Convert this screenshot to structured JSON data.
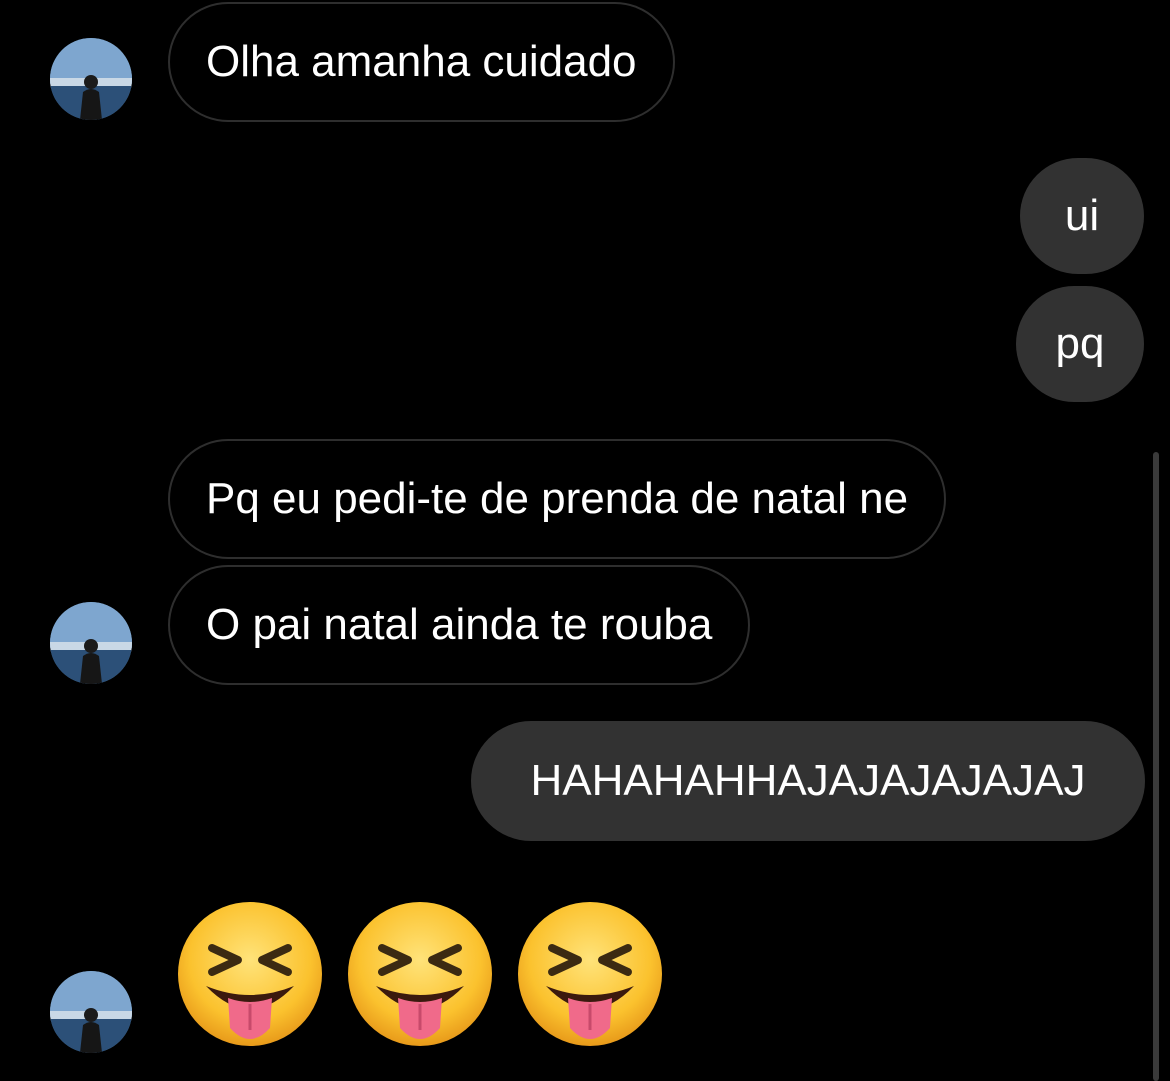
{
  "messages": [
    {
      "from": "them",
      "text": "Olha amanha cuidado"
    },
    {
      "from": "me",
      "text": "ui"
    },
    {
      "from": "me",
      "text": "pq"
    },
    {
      "from": "them",
      "text": "Pq eu pedi-te de prenda de natal ne"
    },
    {
      "from": "them",
      "text": "O pai natal ainda te rouba"
    },
    {
      "from": "me",
      "text": "HAHAHAHHAJAJAJAJAJAJ"
    },
    {
      "from": "them",
      "emoji": [
        "squinting-face-with-tongue",
        "squinting-face-with-tongue",
        "squinting-face-with-tongue"
      ]
    }
  ],
  "colors": {
    "background": "#000000",
    "received_border": "#2e2e2e",
    "sent_bubble": "#323232",
    "text": "#ffffff"
  }
}
